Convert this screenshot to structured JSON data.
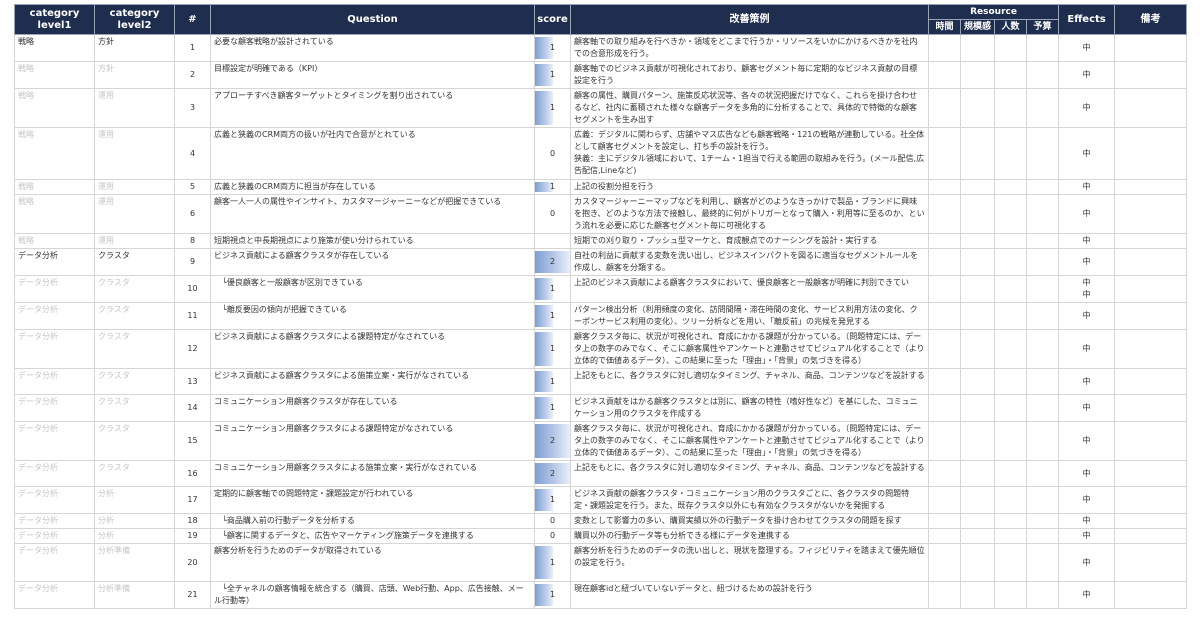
{
  "headers": {
    "cat1": "category\nlevel1",
    "cat2": "category\nlevel2",
    "num": "#",
    "question": "Question",
    "score": "score",
    "improvement": "改善策例",
    "resource": "Resource",
    "res_time": "時間",
    "res_scale": "規模感",
    "res_people": "人数",
    "res_budget": "予算",
    "effects": "Effects",
    "notes": "備考"
  },
  "max_score": 2,
  "rows": [
    {
      "cat1": "戦略",
      "cat2": "方針",
      "num": "1",
      "question": "必要な顧客戦略が設計されている",
      "score": 1,
      "improvement": "顧客軸での取り組みを行べきか・領域をどこまで行うか・リソースをいかにかけるべきかを社内での合意形成を行う。",
      "effects": "中",
      "dim": false,
      "h": 26
    },
    {
      "cat1": "戦略",
      "cat2": "方針",
      "num": "2",
      "question": "目標設定が明確である（KPI）",
      "score": 1,
      "improvement": "顧客軸でのビジネス貢献が可視化されており、顧客セグメント毎に定期的なビジネス貢献の目標設定を行う",
      "effects": "中",
      "dim": true,
      "h": 26
    },
    {
      "cat1": "戦略",
      "cat2": "運用",
      "num": "3",
      "question": "アプローチすべき顧客ターゲットとタイミングを割り出されている",
      "score": 1,
      "improvement": "顧客の属性、購買パターン、施策反応状況等、各々の状況把握だけでなく、これらを掛け合わせるなど、社内に蓄積された様々な顧客データを多角的に分析することで、具体的で特徴的な顧客セグメントを生み出す",
      "effects": "中",
      "dim": true,
      "h": 38
    },
    {
      "cat1": "戦略",
      "cat2": "運用",
      "num": "4",
      "question": "広義と狭義のCRM両方の扱いが社内で合意がとれている",
      "score": 0,
      "improvement": "広義：デジタルに関わらず、店舗やマス広告なども顧客戦略・121の戦略が連動している。社全体として顧客セグメントを設定し、打ち手の設計を行う。\n狭義：主にデジタル領域において、1チーム・1担当で行える範囲の取組みを行う。(メール配信,広告配信,Lineなど)",
      "effects": "中",
      "dim": true,
      "h": 52
    },
    {
      "cat1": "戦略",
      "cat2": "運用",
      "num": "5",
      "question": "広義と狭義のCRM両方に担当が存在している",
      "score": 1,
      "improvement": "上記の役割分担を行う",
      "effects": "中",
      "dim": true,
      "h": 14
    },
    {
      "cat1": "戦略",
      "cat2": "運用",
      "num": "6",
      "question": "顧客一人一人の属性やインサイト、カスタマージャーニーなどが把握できている",
      "score": 0,
      "improvement": "カスタマージャーニーマップなどを利用し、顧客がどのようなきっかけで製品・ブランドに興味を抱き、どのような方法で接触し、最終的に何がトリガーとなって購入・利用等に至るのか、という流れを必要に応じた顧客セグメント毎に可視化する",
      "effects": "中",
      "dim": true,
      "h": 38
    },
    {
      "cat1": "戦略",
      "cat2": "運用",
      "num": "8",
      "question": "短期視点と中長期視点により施策が使い分けられている",
      "score": null,
      "improvement": "短期での刈り取り・プッシュ型マーケと、育成観点でのナーシングを設計・実行する",
      "effects": "中",
      "dim": true,
      "h": 14
    },
    {
      "cat1": "データ分析",
      "cat2": "クラスタ",
      "num": "9",
      "question": "ビジネス貢献による顧客クラスタが存在している",
      "score": 2,
      "improvement": "自社の利益に貢献する変数を洗い出し、ビジネスインパクトを図るに適当なセグメントルールを作成し、顧客を分類する。",
      "effects": "中",
      "dim": false,
      "h": 26,
      "section": true
    },
    {
      "cat1": "データ分析",
      "cat2": "クラスタ",
      "num": "10",
      "question": "　└優良顧客と一般顧客が区別できている",
      "score": 1,
      "improvement": "上記のビジネス貢献による顧客クラスタにおいて、優良顧客と一般顧客が明確に判別できてい",
      "effects": "中\n中",
      "dim": true,
      "h": 24
    },
    {
      "cat1": "データ分析",
      "cat2": "クラスタ",
      "num": "11",
      "question": "　└離反要因の傾向が把握できている",
      "score": 1,
      "improvement": "パターン検出分析（利用頻度の変化、訪問間隔・滞在時間の変化、サービス利用方法の変化、クーポンサービス利用の変化）、ツリー分析などを用い、「離反前」の兆候を発見する",
      "effects": "中",
      "dim": true,
      "h": 26
    },
    {
      "cat1": "データ分析",
      "cat2": "クラスタ",
      "num": "12",
      "question": "ビジネス貢献による顧客クラスタによる課題特定がなされている",
      "score": 1,
      "improvement": "顧客クラスタ毎に、状況が可視化され、育成にかかる課題が分かっている。（問題特定には、データ上の数字のみでなく、そこに顧客属性やアンケートと連動させてビジュアル化することで（より立体的で価値あるデータ）、この結果に至った「理由」・「背景」の気づきを得る）",
      "effects": "中",
      "dim": true,
      "h": 38
    },
    {
      "cat1": "データ分析",
      "cat2": "クラスタ",
      "num": "13",
      "question": "ビジネス貢献による顧客クラスタによる施策立案・実行がなされている",
      "score": 1,
      "improvement": "上記をもとに、各クラスタに対し適切なタイミング、チャネル、商品、コンテンツなどを設計する",
      "effects": "中",
      "dim": true,
      "h": 26
    },
    {
      "cat1": "データ分析",
      "cat2": "クラスタ",
      "num": "14",
      "question": "コミュニケーション用顧客クラスタが存在している",
      "score": 1,
      "improvement": "ビジネス貢献をはかる顧客クラスタとは別に、顧客の特性（嗜好性など）を基にした、コミュニケーション用のクラスタを作成する",
      "effects": "中",
      "dim": true,
      "h": 26
    },
    {
      "cat1": "データ分析",
      "cat2": "クラスタ",
      "num": "15",
      "question": "コミュニケーション用顧客クラスタによる課題特定がなされている",
      "score": 2,
      "improvement": "顧客クラスタ毎に、状況が可視化され、育成にかかる課題が分かっている。（問題特定には、データ上の数字のみでなく、そこに顧客属性やアンケートと連動させてビジュアル化することで（より立体的で価値あるデータ）、この結果に至った「理由」・「背景」の気づきを得る）",
      "effects": "中",
      "dim": true,
      "h": 38
    },
    {
      "cat1": "データ分析",
      "cat2": "クラスタ",
      "num": "16",
      "question": "コミュニケーション用顧客クラスタによる施策立案・実行がなされている",
      "score": 2,
      "improvement": "上記をもとに、各クラスタに対し適切なタイミング、チャネル、商品、コンテンツなどを設計する",
      "effects": "中",
      "dim": true,
      "h": 26
    },
    {
      "cat1": "データ分析",
      "cat2": "分析",
      "num": "17",
      "question": "定期的に顧客軸での問題特定・課題設定が行われている",
      "score": 1,
      "improvement": "ビジネス貢献の顧客クラスタ・コミュニケーション用のクラスタごとに、各クラスタの問題特定・課題設定を行う。また、既存クラスタ以外にも有効なクラスタがないかを発掘する",
      "effects": "中",
      "dim": true,
      "h": 26
    },
    {
      "cat1": "データ分析",
      "cat2": "分析",
      "num": "18",
      "question": "　└商品購入前の行動データを分析する",
      "score": 0,
      "improvement": "変数として影響力の多い、購買実績以外の行動データを掛け合わせてクラスタの問題を探す",
      "effects": "中",
      "dim": true,
      "h": 14
    },
    {
      "cat1": "データ分析",
      "cat2": "分析",
      "num": "19",
      "question": "　└顧客に関するデータと、広告やマーケティング施策データを連携する",
      "score": 0,
      "improvement": "購買以外の行動データ等も分析できる様にデータを連携する",
      "effects": "中",
      "dim": true,
      "h": 14
    },
    {
      "cat1": "データ分析",
      "cat2": "分析準備",
      "num": "20",
      "question": "顧客分析を行うためのデータが取得されている",
      "score": 1,
      "improvement": "顧客分析を行うためのデータの洗い出しと、現状を整理する。フィジビリティを踏まえて優先順位の設定を行う。",
      "effects": "中",
      "dim": true,
      "h": 38
    },
    {
      "cat1": "データ分析",
      "cat2": "分析準備",
      "num": "21",
      "question": "　└全チャネルの顧客情報を統合する（購買、店頭、Web行動、App、広告接触、メール行動等）",
      "score": 1,
      "improvement": "現在顧客idと紐づいていないデータと、紐づけるための設計を行う",
      "effects": "中",
      "dim": true,
      "h": 26
    }
  ]
}
